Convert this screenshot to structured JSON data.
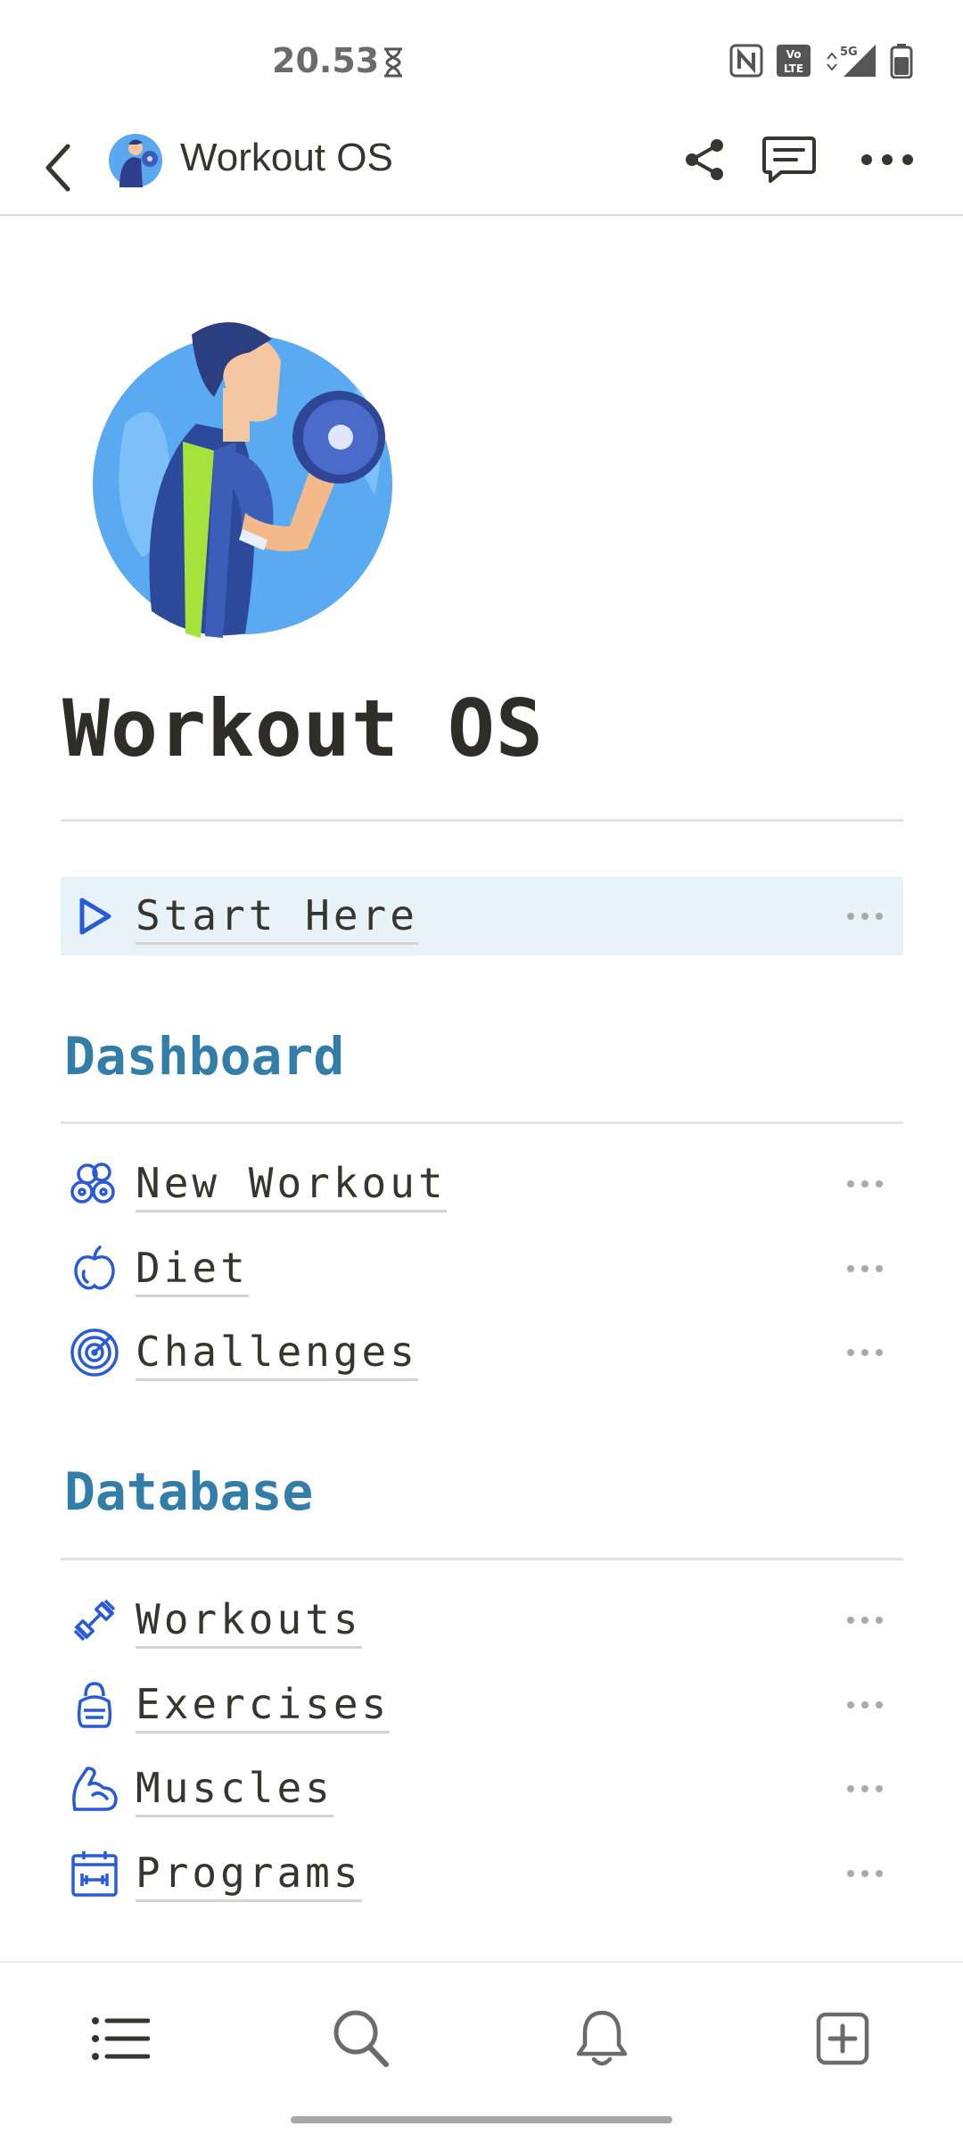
{
  "status": {
    "time": "20.53"
  },
  "topbar": {
    "title": "Workout OS"
  },
  "page": {
    "title": "Workout OS",
    "callout": {
      "label": "Start Here"
    },
    "sections": [
      {
        "heading": "Dashboard",
        "items": [
          "New Workout",
          "Diet",
          "Challenges"
        ]
      },
      {
        "heading": "Database",
        "items": [
          "Workouts",
          "Exercises",
          "Muscles",
          "Programs"
        ]
      }
    ]
  },
  "icons": {
    "new_workout": "weights-icon",
    "diet": "apple-icon",
    "challenges": "target-icon",
    "workouts": "dumbbell-icon",
    "exercises": "kettlebell-icon",
    "muscles": "bicep-icon",
    "programs": "calendar-icon"
  },
  "colors": {
    "accent": "#337ea9",
    "callout_bg": "#e7f3f8",
    "icon_blue": "#2a5bd7"
  }
}
